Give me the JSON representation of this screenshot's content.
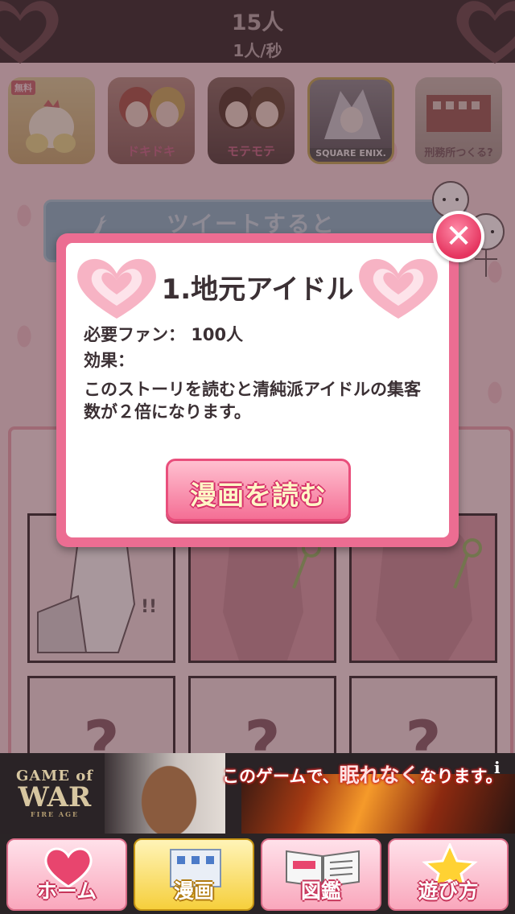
{
  "header": {
    "fans": "15人",
    "rate": "1人/秒"
  },
  "apps": [
    {
      "id": "app1",
      "badge": "無料",
      "label": ""
    },
    {
      "id": "app2",
      "label": "ドキドキ"
    },
    {
      "id": "app3",
      "label": "モテモテ"
    },
    {
      "id": "app4",
      "label": "SQUARE ENIX."
    },
    {
      "id": "app5",
      "label": "刑務所つくる?"
    }
  ],
  "tweet": {
    "text": "ツイートすると",
    "icon": "twitter-bird-icon"
  },
  "modal": {
    "title": "1.地元アイドル",
    "required_label": "必要ファン：",
    "required_value": "100人",
    "effect_label": "効果：",
    "effect_text": "このストーリを読むと清純派アイドルの集客数が２倍になります。",
    "read_button": "漫画を読む",
    "close_icon": "close-icon"
  },
  "comics": {
    "unknown_mark": "?"
  },
  "ad": {
    "brand_line1": "GAME of",
    "brand_line2": "WAR",
    "brand_line3": "FIRE AGE",
    "copy_pre": "このゲームで、",
    "copy_big": "眠れなく",
    "copy_post": "なります。",
    "info": "i"
  },
  "tabs": [
    {
      "label": "ホーム",
      "icon": "heart-icon",
      "active": false
    },
    {
      "label": "漫画",
      "icon": "building-icon",
      "active": true
    },
    {
      "label": "図鑑",
      "icon": "book-icon",
      "active": false
    },
    {
      "label": "遊び方",
      "icon": "star-icon",
      "active": false
    }
  ],
  "colors": {
    "accent": "#ec6d92",
    "header": "#3d2f31",
    "active_tab": "#f6cf3c"
  }
}
